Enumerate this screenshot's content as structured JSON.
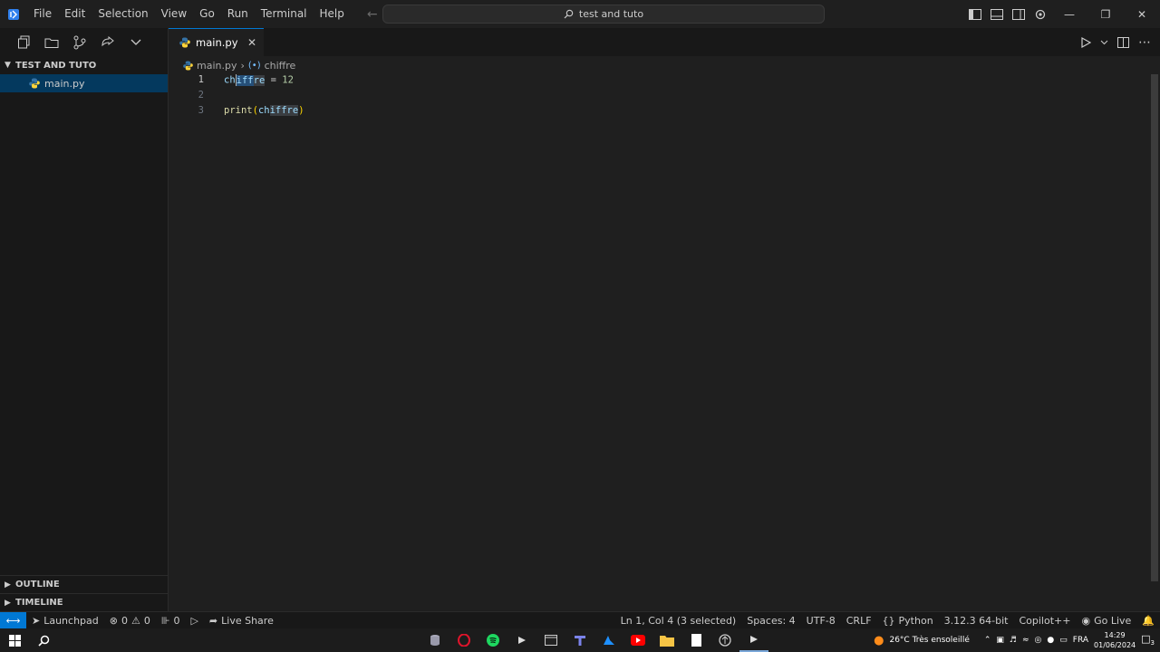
{
  "titlebar": {
    "menu": [
      "File",
      "Edit",
      "Selection",
      "View",
      "Go",
      "Run",
      "Terminal",
      "Help"
    ],
    "search_text": "test and tuto"
  },
  "sidebar": {
    "folder_name": "TEST AND TUTO",
    "files": [
      {
        "name": "main.py",
        "icon": "python-icon"
      }
    ],
    "outline_label": "OUTLINE",
    "timeline_label": "TIMELINE"
  },
  "editor": {
    "tab_label": "main.py",
    "breadcrumb_file": "main.py",
    "breadcrumb_symbol": "chiffre",
    "line_numbers": [
      "1",
      "2",
      "3"
    ]
  },
  "statusbar": {
    "launchpad": "Launchpad",
    "errors": "0",
    "warnings": "0",
    "ports": "0",
    "live_share": "Live Share",
    "cursor": "Ln 1, Col 4 (3 selected)",
    "spaces": "Spaces: 4",
    "encoding": "UTF-8",
    "eol": "CRLF",
    "language": "Python",
    "interpreter": "3.12.3 64-bit",
    "copilot": "Copilot++",
    "go_live": "Go Live"
  },
  "taskbar": {
    "weather": "26°C  Très ensoleillé",
    "lang": "FRA",
    "time": "14:29",
    "date": "01/06/2024",
    "notifications": "3"
  },
  "colors": {
    "accent": "#0078d4",
    "selection": "#264f78",
    "python_blue": "#3572a5",
    "python_yellow": "#ffd43b"
  }
}
